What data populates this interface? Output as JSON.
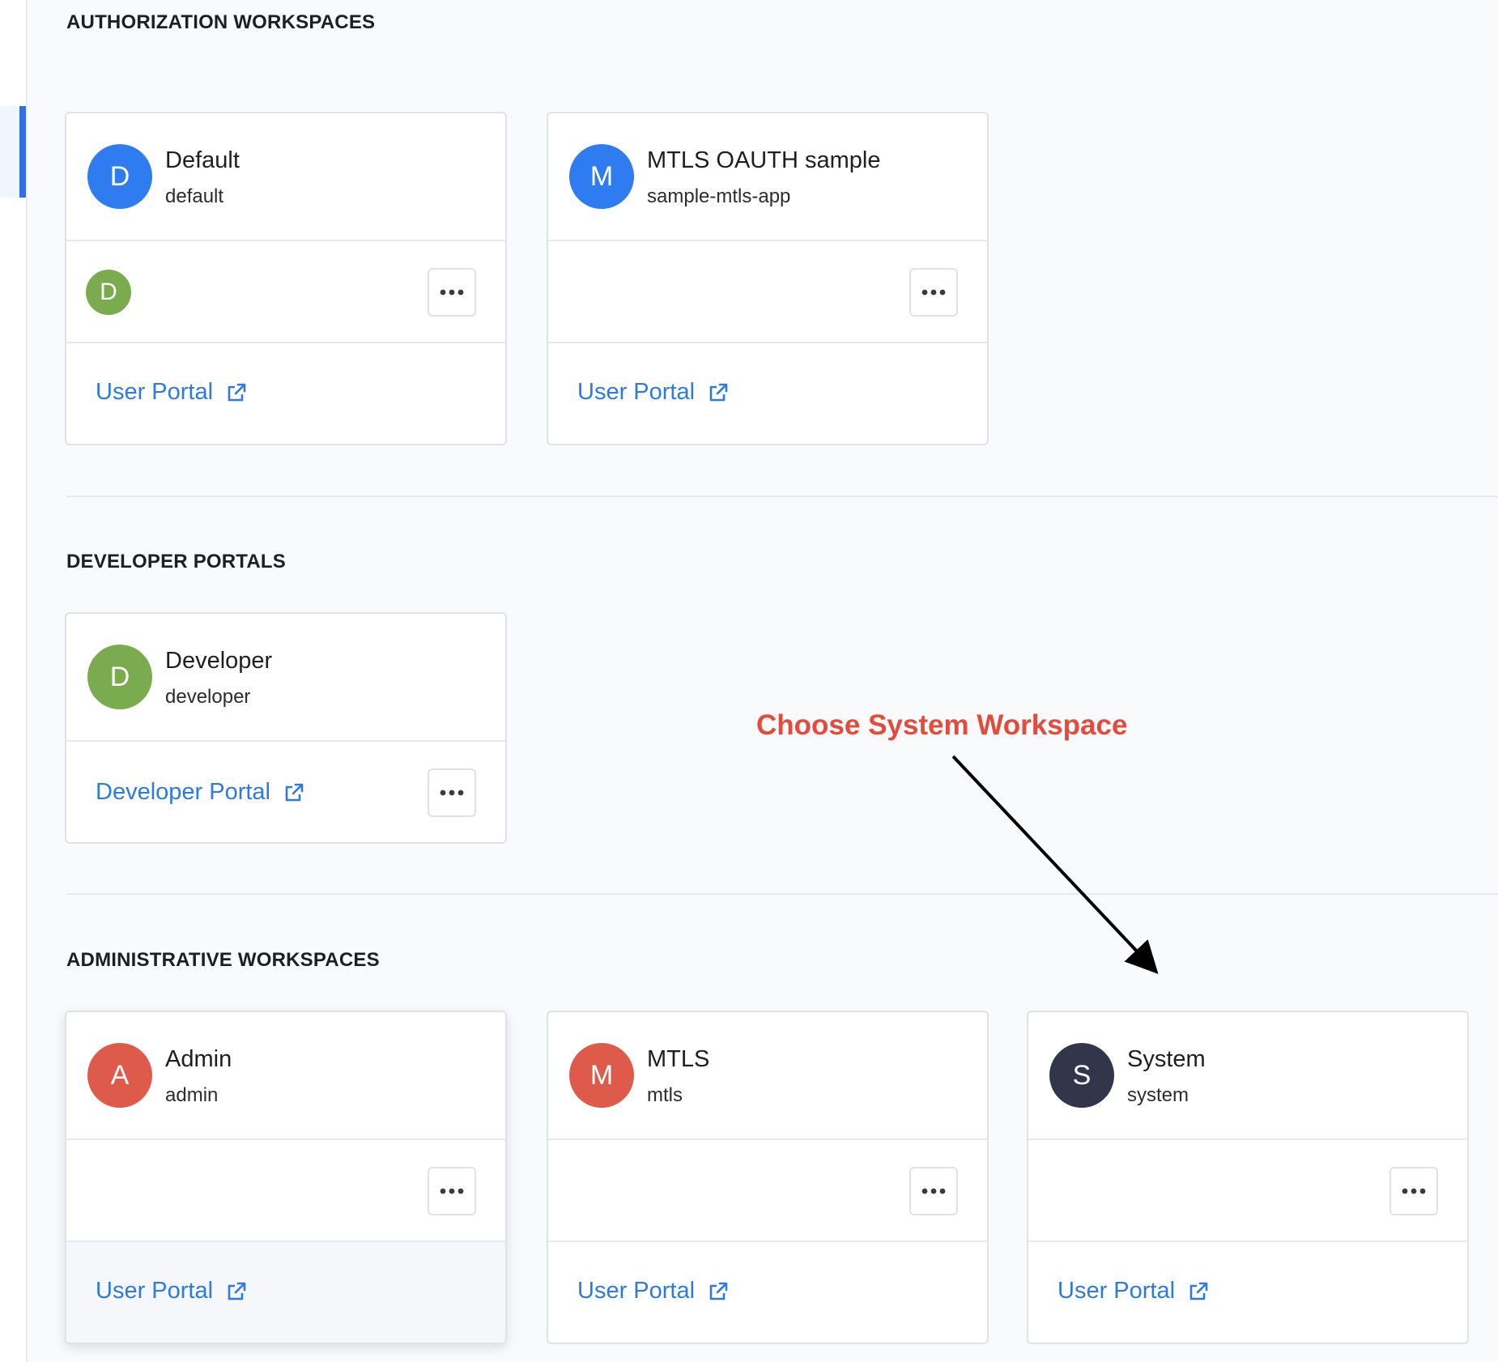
{
  "sections": [
    {
      "title": "AUTHORIZATION WORKSPACES",
      "cards": [
        {
          "initial": "D",
          "name": "Default",
          "id": "default",
          "avatar_color": "#2f7bf0",
          "member_initial": "D",
          "member_color": "#7aac4f",
          "link_label": "User Portal"
        },
        {
          "initial": "M",
          "name": "MTLS OAUTH sample",
          "id": "sample-mtls-app",
          "avatar_color": "#2f7bf0",
          "link_label": "User Portal"
        }
      ]
    },
    {
      "title": "DEVELOPER PORTALS",
      "cards": [
        {
          "initial": "D",
          "name": "Developer",
          "id": "developer",
          "avatar_color": "#7aac4f",
          "link_label": "Developer Portal"
        }
      ]
    },
    {
      "title": "ADMINISTRATIVE WORKSPACES",
      "cards": [
        {
          "initial": "A",
          "name": "Admin",
          "id": "admin",
          "avatar_color": "#de5a4a",
          "link_label": "User Portal"
        },
        {
          "initial": "M",
          "name": "MTLS",
          "id": "mtls",
          "avatar_color": "#de5a4a",
          "link_label": "User Portal"
        },
        {
          "initial": "S",
          "name": "System",
          "id": "system",
          "avatar_color": "#33364a",
          "link_label": "User Portal"
        }
      ]
    }
  ],
  "annotation": {
    "text": "Choose System Workspace",
    "color": "#e44b3b"
  },
  "icons": {
    "menu": "ellipsis-icon",
    "link": "external-link-icon"
  },
  "accent": "#2d7ae0"
}
